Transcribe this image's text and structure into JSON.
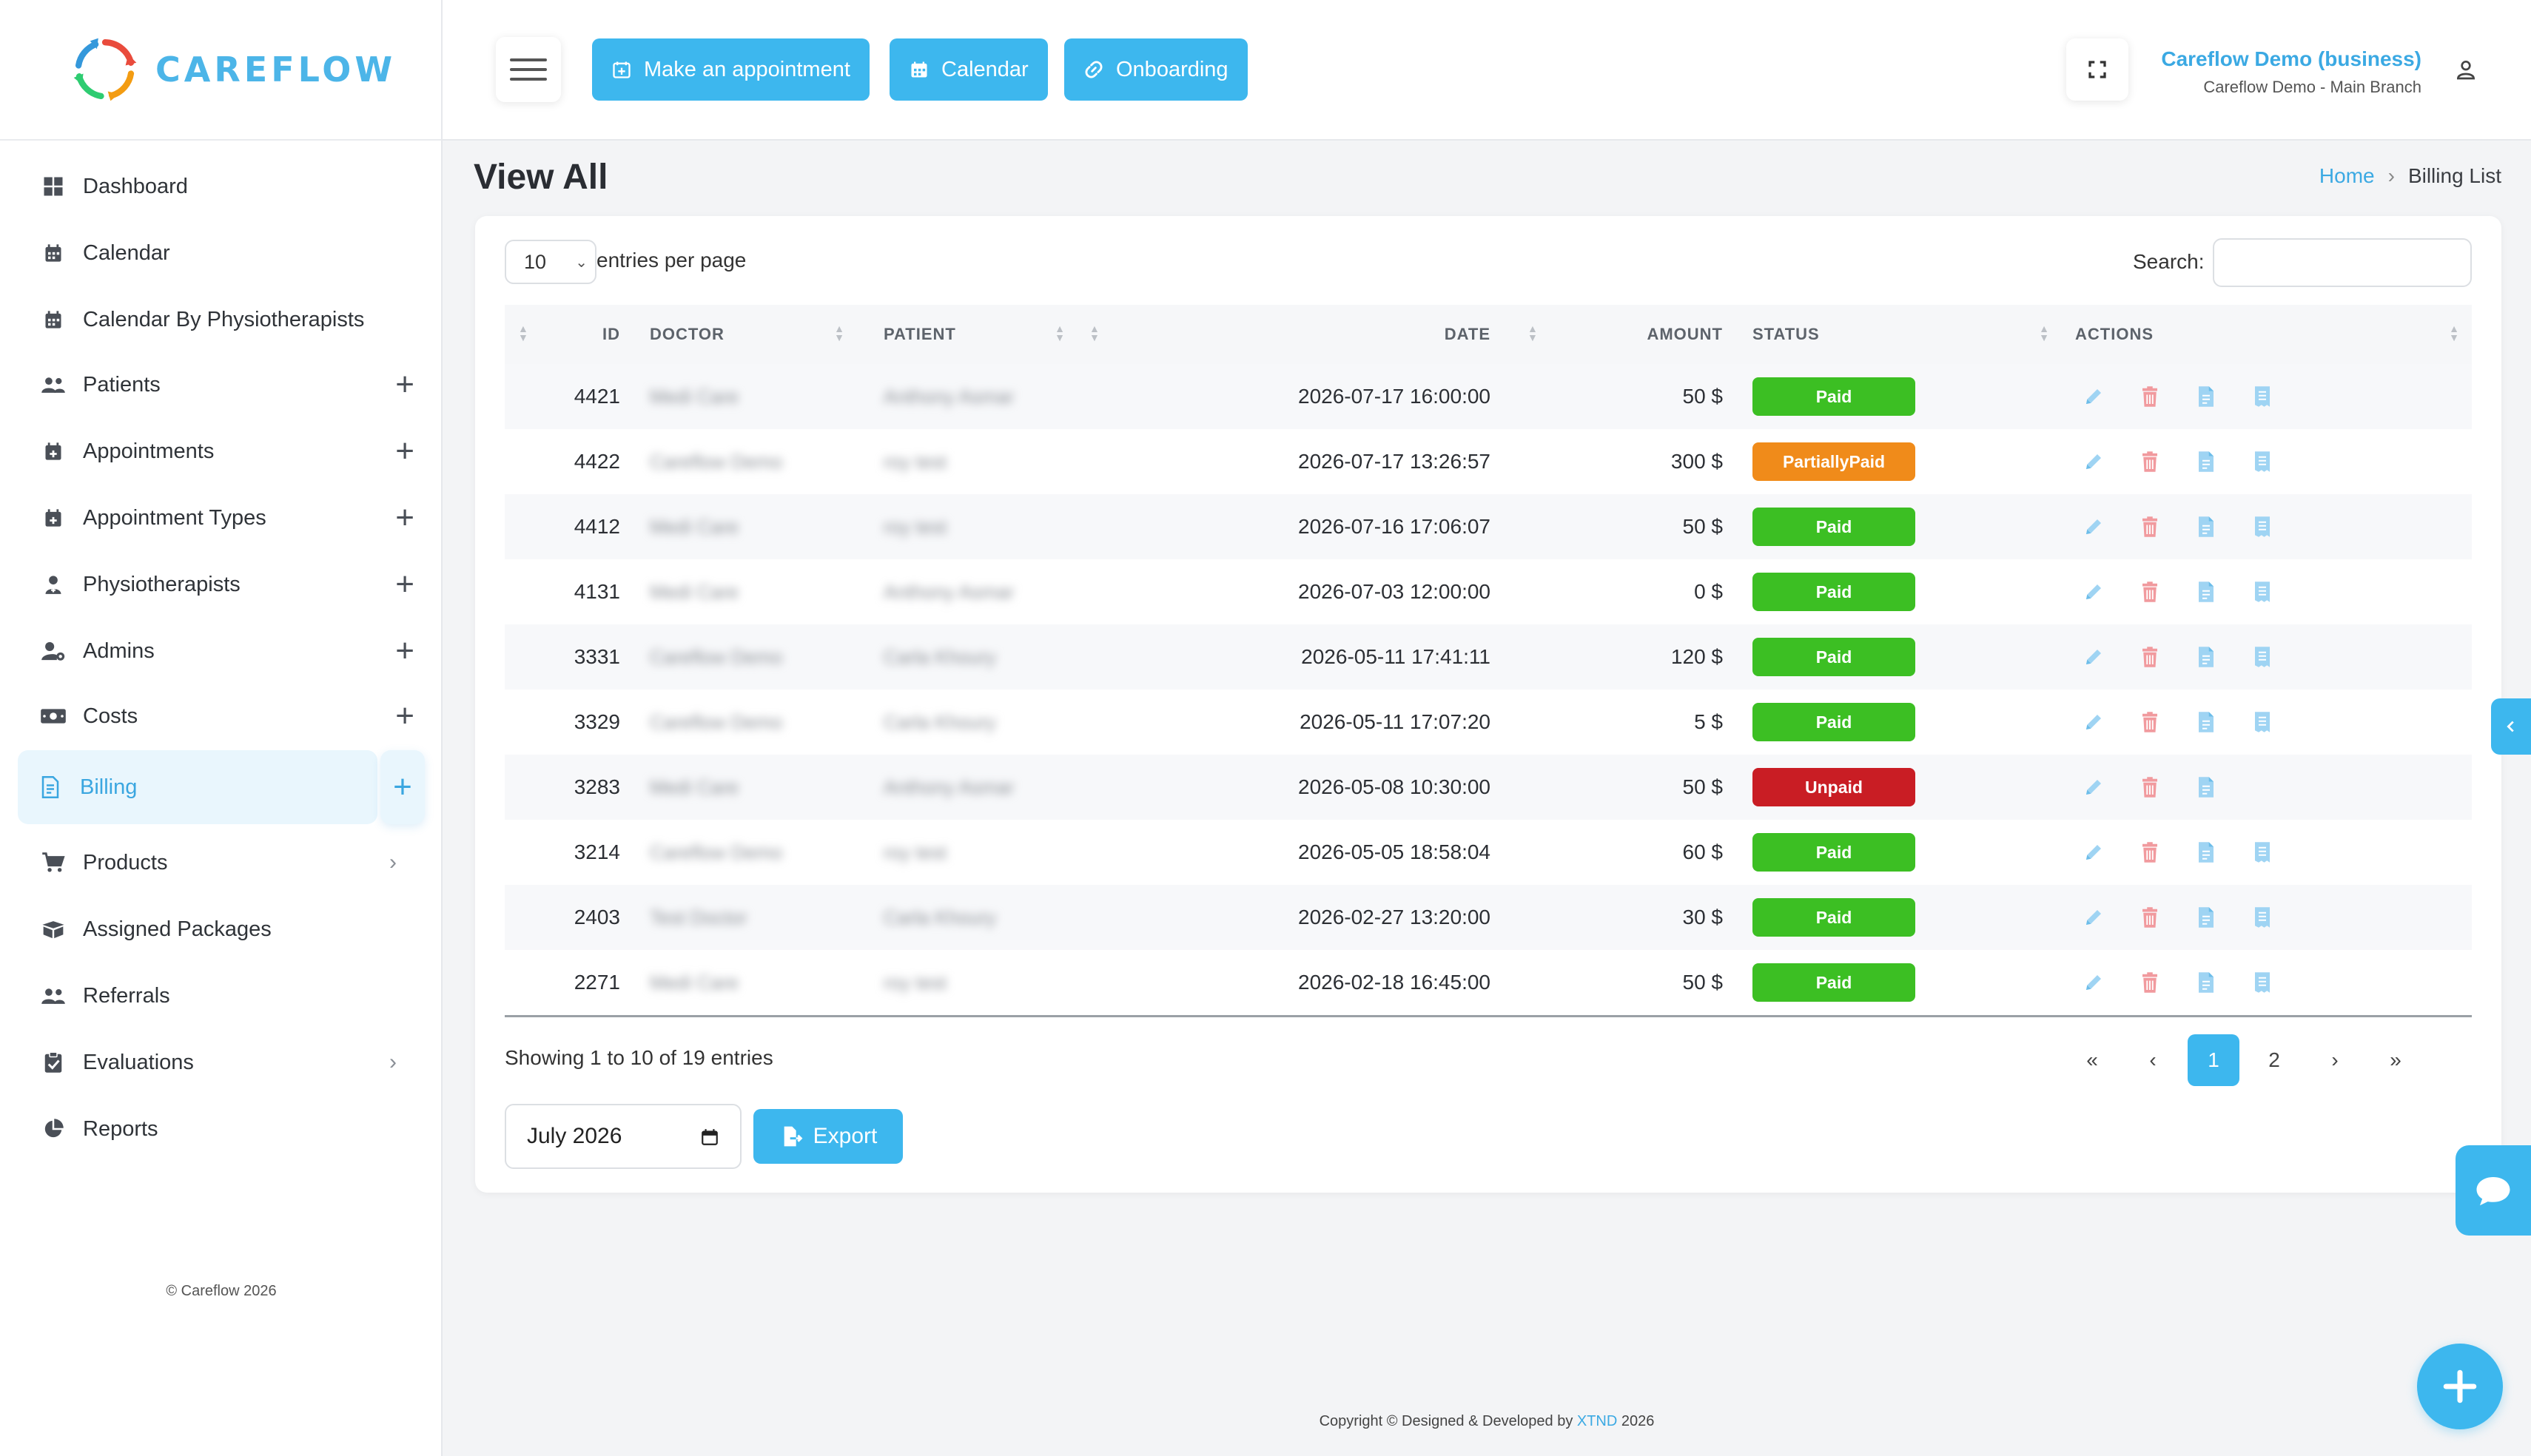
{
  "app": {
    "logo_text": "CAREFLOW"
  },
  "header": {
    "buttons": [
      {
        "label": "Make an appointment",
        "icon": "calendar-plus-icon"
      },
      {
        "label": "Calendar",
        "icon": "calendar-icon"
      },
      {
        "label": "Onboarding",
        "icon": "link-icon"
      }
    ],
    "user_name": "Careflow Demo (business)",
    "user_branch": "Careflow Demo - Main Branch"
  },
  "sidebar": {
    "items": [
      {
        "label": "Dashboard",
        "icon": "dashboard-icon",
        "expand": ""
      },
      {
        "label": "Calendar",
        "icon": "calendar-icon",
        "expand": ""
      },
      {
        "label": "Calendar By Physiotherapists",
        "icon": "calendar-icon",
        "expand": ""
      },
      {
        "label": "Patients",
        "icon": "users-icon",
        "expand": "+"
      },
      {
        "label": "Appointments",
        "icon": "calendar-plus-icon",
        "expand": "+"
      },
      {
        "label": "Appointment Types",
        "icon": "calendar-plus-icon",
        "expand": "+"
      },
      {
        "label": "Physiotherapists",
        "icon": "doctor-icon",
        "expand": "+"
      },
      {
        "label": "Admins",
        "icon": "user-cog-icon",
        "expand": "+"
      },
      {
        "label": "Costs",
        "icon": "money-icon",
        "expand": "+"
      },
      {
        "label": "Billing",
        "icon": "invoice-icon",
        "expand": "+"
      },
      {
        "label": "Products",
        "icon": "cart-icon",
        "expand": "›"
      },
      {
        "label": "Assigned Packages",
        "icon": "box-icon",
        "expand": ""
      },
      {
        "label": "Referrals",
        "icon": "users-icon",
        "expand": ""
      },
      {
        "label": "Evaluations",
        "icon": "clipboard-icon",
        "expand": "›"
      },
      {
        "label": "Reports",
        "icon": "pie-chart-icon",
        "expand": ""
      }
    ],
    "footer": "© Careflow 2026"
  },
  "page": {
    "title": "View All",
    "breadcrumb": {
      "home": "Home",
      "current": "Billing List"
    }
  },
  "table_controls": {
    "entries_value": "10",
    "entries_label": "entries per page",
    "search_label": "Search:",
    "search_value": ""
  },
  "table": {
    "columns": [
      "ID",
      "DOCTOR",
      "PATIENT",
      "DATE",
      "AMOUNT",
      "STATUS",
      "ACTIONS"
    ],
    "rows": [
      {
        "id": "4421",
        "doctor": "Medi Care",
        "patient": "Anthony Asmar",
        "date": "2026-07-17 16:00:00",
        "amount": "50 $",
        "status": "Paid",
        "invoice_action": true
      },
      {
        "id": "4422",
        "doctor": "Careflow Demo",
        "patient": "roy test",
        "date": "2026-07-17 13:26:57",
        "amount": "300 $",
        "status": "PartiallyPaid",
        "invoice_action": true
      },
      {
        "id": "4412",
        "doctor": "Medi Care",
        "patient": "roy test",
        "date": "2026-07-16 17:06:07",
        "amount": "50 $",
        "status": "Paid",
        "invoice_action": true
      },
      {
        "id": "4131",
        "doctor": "Medi Care",
        "patient": "Anthony Asmar",
        "date": "2026-07-03 12:00:00",
        "amount": "0 $",
        "status": "Paid",
        "invoice_action": true
      },
      {
        "id": "3331",
        "doctor": "Careflow Demo",
        "patient": "Carla Khoury",
        "date": "2026-05-11 17:41:11",
        "amount": "120 $",
        "status": "Paid",
        "invoice_action": true
      },
      {
        "id": "3329",
        "doctor": "Careflow Demo",
        "patient": "Carla Khoury",
        "date": "2026-05-11 17:07:20",
        "amount": "5 $",
        "status": "Paid",
        "invoice_action": true
      },
      {
        "id": "3283",
        "doctor": "Medi Care",
        "patient": "Anthony Asmar",
        "date": "2026-05-08 10:30:00",
        "amount": "50 $",
        "status": "Unpaid",
        "invoice_action": false
      },
      {
        "id": "3214",
        "doctor": "Careflow Demo",
        "patient": "roy test",
        "date": "2026-05-05 18:58:04",
        "amount": "60 $",
        "status": "Paid",
        "invoice_action": true
      },
      {
        "id": "2403",
        "doctor": "Test Doctor",
        "patient": "Carla Khoury",
        "date": "2026-02-27 13:20:00",
        "amount": "30 $",
        "status": "Paid",
        "invoice_action": true
      },
      {
        "id": "2271",
        "doctor": "Medi Care",
        "patient": "roy test",
        "date": "2026-02-18 16:45:00",
        "amount": "50 $",
        "status": "Paid",
        "invoice_action": true
      }
    ]
  },
  "status_colors": {
    "Paid": "#3cbf23",
    "PartiallyPaid": "#f08b1a",
    "Unpaid": "#c91d24"
  },
  "pagination": {
    "showing": "Showing 1 to 10 of 19 entries",
    "first": "«",
    "prev": "‹",
    "pages": [
      "1",
      "2"
    ],
    "current": "1",
    "next": "›",
    "last": "»"
  },
  "export": {
    "month_value": "July 2026",
    "button_label": "Export"
  },
  "footer": {
    "prefix": "Copyright © Designed & Developed by ",
    "brand": "XTND",
    "suffix": " 2026"
  },
  "colors": {
    "accent": "#3db7ee",
    "link": "#3ba9e3"
  }
}
